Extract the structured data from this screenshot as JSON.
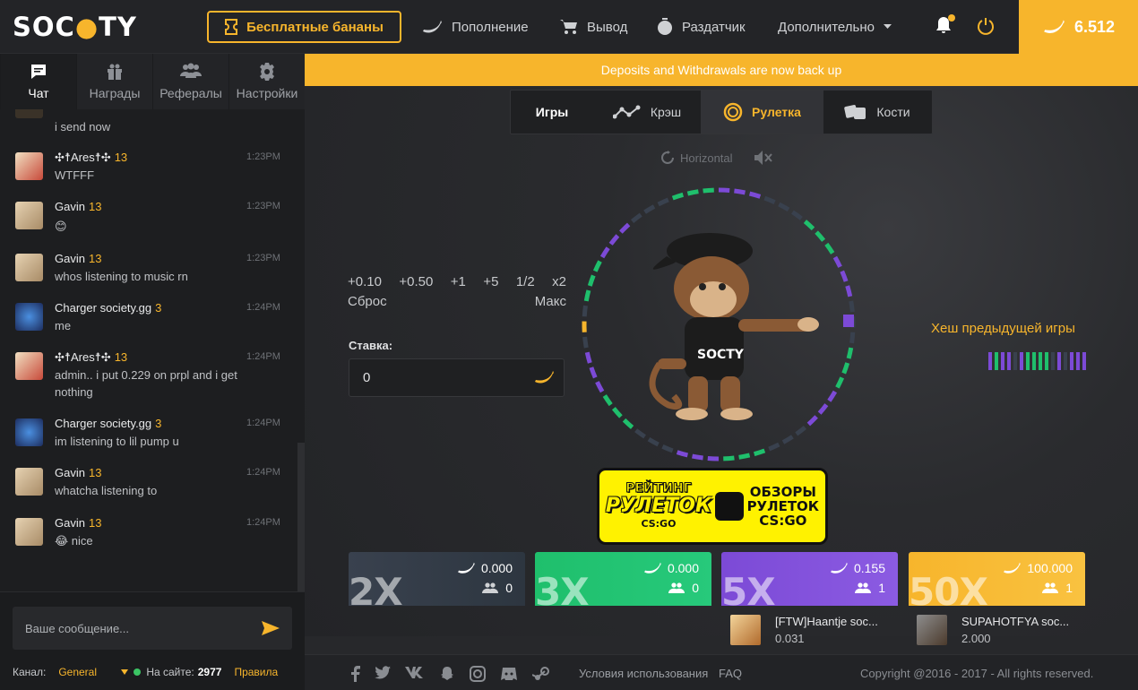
{
  "header": {
    "logo": {
      "pre": "SOC",
      "dot": "●",
      "post": "TY"
    },
    "free_bananas": "Бесплатные бананы",
    "nav": [
      {
        "label": "Пополнение",
        "icon": "banana-icon"
      },
      {
        "label": "Вывод",
        "icon": "cart-icon"
      },
      {
        "label": "Раздатчик",
        "icon": "timer-icon"
      },
      {
        "label": "Дополнительно",
        "icon": "chevron-down-icon"
      }
    ],
    "balance": "6.512"
  },
  "sidebar": {
    "tabs": [
      {
        "label": "Чат",
        "icon": "chat-icon"
      },
      {
        "label": "Награды",
        "icon": "gift-icon"
      },
      {
        "label": "Рефералы",
        "icon": "users-icon"
      },
      {
        "label": "Настройки",
        "icon": "gear-icon"
      }
    ],
    "messages": [
      {
        "user": "",
        "level": "",
        "text": "i send now",
        "time": "",
        "avatar_color": "#3a3228"
      },
      {
        "user": "✣☨Ares☨✣",
        "level": "13",
        "text": "WTFFF",
        "time": "1:23PM",
        "avatar_color": "#e9d5b0"
      },
      {
        "user": "Gavin",
        "level": "13",
        "text": "😊",
        "time": "1:23PM",
        "avatar_color": "#d9c3a0"
      },
      {
        "user": "Gavin",
        "level": "13",
        "text": "whos listening to music rn",
        "time": "1:23PM",
        "avatar_color": "#d9c3a0"
      },
      {
        "user": "Charger society.gg",
        "level": "3",
        "text": "me",
        "time": "1:24PM",
        "avatar_color": "#2a4b8d"
      },
      {
        "user": "✣☨Ares☨✣",
        "level": "13",
        "text": "admin.. i put 0.229 on prpl and i get nothing",
        "time": "1:24PM",
        "avatar_color": "#e9d5b0"
      },
      {
        "user": "Charger society.gg",
        "level": "3",
        "text": "im listening to lil pump u",
        "time": "1:24PM",
        "avatar_color": "#2a4b8d"
      },
      {
        "user": "Gavin",
        "level": "13",
        "text": "whatcha listening to",
        "time": "1:24PM",
        "avatar_color": "#d9c3a0"
      },
      {
        "user": "Gavin",
        "level": "13",
        "text": "😂 nice",
        "time": "1:24PM",
        "avatar_color": "#d9c3a0"
      }
    ],
    "input_placeholder": "Ваше сообщение...",
    "channel_label": "Канал:",
    "channel": "General",
    "online_label": "На сайте:",
    "online_count": "2977",
    "rules": "Правила"
  },
  "main": {
    "banner": "Deposits and Withdrawals are now back up",
    "games_label": "Игры",
    "game_tabs": [
      {
        "label": "Крэш",
        "icon": "crash-icon"
      },
      {
        "label": "Рулетка",
        "icon": "roulette-icon"
      },
      {
        "label": "Кости",
        "icon": "dice-icon"
      }
    ],
    "orientation": "Horizontal",
    "quick_bets": [
      "+0.10",
      "+0.50",
      "+1",
      "+5",
      "1/2",
      "x2"
    ],
    "reset": "Сброс",
    "max": "Макс",
    "stake_label": "Ставка:",
    "stake_value": "0",
    "hash_title": "Хеш предыдущей игры",
    "hash_colors": [
      "#7c4ad6",
      "#1fbf6c",
      "#7c4ad6",
      "#7c4ad6",
      "#39414e",
      "#7c4ad6",
      "#1fbf6c",
      "#1fbf6c",
      "#1fbf6c",
      "#1fbf6c",
      "#39414e",
      "#7c4ad6",
      "#39414e",
      "#7c4ad6",
      "#7c4ad6",
      "#7c4ad6"
    ],
    "ad": {
      "left_top": "РЕЙТИНГ",
      "left_bottom": "РУЛЕТОК",
      "left_sub": "CS:GO",
      "right": [
        "ОБЗОРЫ",
        "РУЛЕТОК",
        "CS:GO"
      ]
    },
    "bets": [
      {
        "mult": "2X",
        "amount": "0.000",
        "players": "0"
      },
      {
        "mult": "3X",
        "amount": "0.000",
        "players": "0"
      },
      {
        "mult": "5X",
        "amount": "0.155",
        "players": "1"
      },
      {
        "mult": "50X",
        "amount": "100.000",
        "players": "1"
      }
    ],
    "players": [
      {
        "name": "[FTW]Haantje soc...",
        "amount": "0.031",
        "avatar_color": "#c9933b"
      },
      {
        "name": "SUPAHOTFYA soc...",
        "amount": "2.000",
        "avatar_color": "#6b5440"
      }
    ]
  },
  "footer": {
    "social": [
      "facebook-icon",
      "twitter-icon",
      "vk-icon",
      "snapchat-icon",
      "instagram-icon",
      "discord-icon",
      "steam-icon"
    ],
    "terms": "Условия использования",
    "faq": "FAQ",
    "copyright": "Copyright @2016 - 2017 - All rights reserved."
  },
  "colors": {
    "accent": "#f7b52c",
    "green": "#1fbf6c",
    "purple": "#7c4ad6",
    "gray": "#39414e"
  }
}
